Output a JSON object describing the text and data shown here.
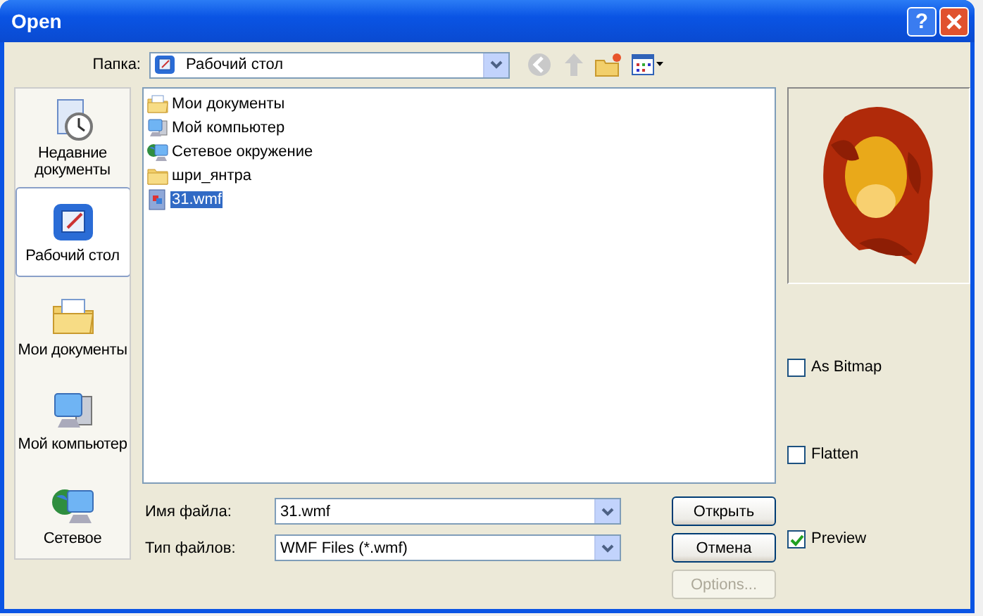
{
  "window": {
    "title": "Open",
    "help_button": "?"
  },
  "folder": {
    "label": "Папка:",
    "value": "Рабочий стол"
  },
  "places": [
    {
      "label": "Недавние документы",
      "kind": "recent",
      "selected": false
    },
    {
      "label": "Рабочий стол",
      "kind": "desktop",
      "selected": true
    },
    {
      "label": "Мои документы",
      "kind": "documents",
      "selected": false
    },
    {
      "label": "Мой компьютер",
      "kind": "computer",
      "selected": false
    },
    {
      "label": "Сетевое",
      "kind": "network",
      "selected": false
    }
  ],
  "files": [
    {
      "name": "Мои документы",
      "kind": "documents",
      "selected": false
    },
    {
      "name": "Мой компьютер",
      "kind": "computer",
      "selected": false
    },
    {
      "name": "Сетевое окружение",
      "kind": "network",
      "selected": false
    },
    {
      "name": "шри_янтра",
      "kind": "folder",
      "selected": false
    },
    {
      "name": "31.wmf",
      "kind": "wmf",
      "selected": true
    }
  ],
  "file_name": {
    "label": "Имя файла:",
    "value": "31.wmf"
  },
  "file_type": {
    "label": "Тип файлов:",
    "value": "WMF Files (*.wmf)"
  },
  "buttons": [
    {
      "label": "Открыть",
      "disabled": false
    },
    {
      "label": "Отмена",
      "disabled": false
    },
    {
      "label": "Options...",
      "disabled": true
    }
  ],
  "options": [
    {
      "label": "As Bitmap",
      "checked": false
    },
    {
      "label": "Flatten",
      "checked": false
    },
    {
      "label": "Preview",
      "checked": true
    }
  ]
}
